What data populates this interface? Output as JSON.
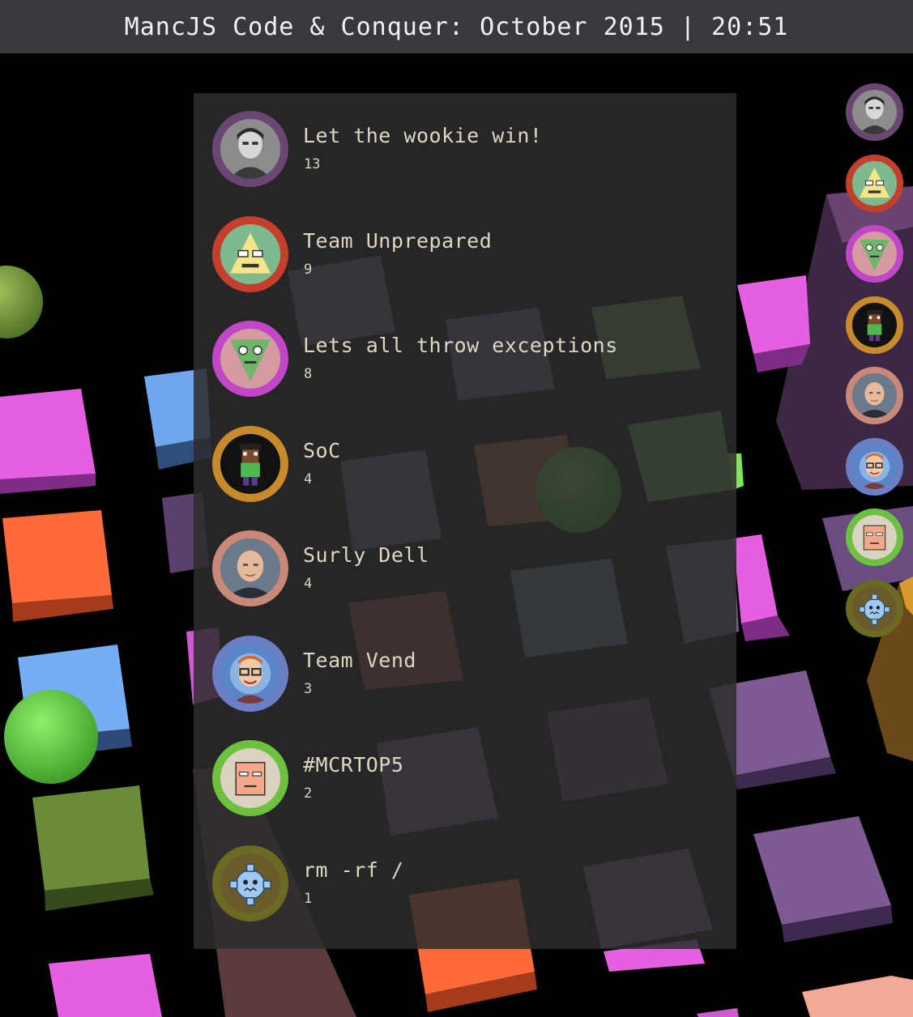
{
  "header": {
    "title": "MancJS Code & Conquer: October 2015 | 20:51"
  },
  "leaderboard": [
    {
      "name": "Let the wookie win!",
      "score": "13",
      "ring_color": "#6a4672",
      "avatar_icon": "man-portrait-icon"
    },
    {
      "name": "Team Unprepared",
      "score": "9",
      "ring_color": "#c5402c",
      "avatar_icon": "triangle-face-icon"
    },
    {
      "name": "Lets all throw exceptions",
      "score": "8",
      "ring_color": "#c146c8",
      "avatar_icon": "inverted-triangle-face-icon"
    },
    {
      "name": "SoC",
      "score": "4",
      "ring_color": "#c98a2c",
      "avatar_icon": "pixel-character-icon"
    },
    {
      "name": "Surly Dell",
      "score": "4",
      "ring_color": "#c98878",
      "avatar_icon": "bald-man-portrait-icon"
    },
    {
      "name": "Team Vend",
      "score": "3",
      "ring_color": "#6a7fc6",
      "avatar_icon": "cartoon-glasses-icon"
    },
    {
      "name": "#MCRTOP5",
      "score": "2",
      "ring_color": "#6cc23f",
      "avatar_icon": "square-face-icon"
    },
    {
      "name": "rm -rf /",
      "score": "1",
      "ring_color": "#6a6a22",
      "avatar_icon": "gear-face-icon"
    }
  ]
}
